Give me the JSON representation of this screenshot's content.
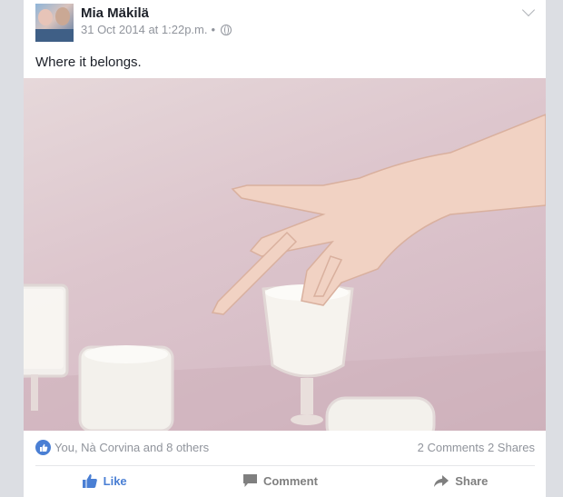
{
  "post": {
    "author": "Mia Mäkilä",
    "timestamp": "31 Oct 2014 at 1:22p.m.",
    "separator": "•",
    "privacy_icon": "globe-icon",
    "text": "Where it belongs."
  },
  "reactions": {
    "summary": "You, Nà Corvina and 8 others",
    "comments": "2 Comments",
    "shares": "2 Shares"
  },
  "actions": {
    "like": "Like",
    "comment": "Comment",
    "share": "Share"
  },
  "colors": {
    "accent": "#4a7fd4",
    "muted": "#90949c"
  }
}
